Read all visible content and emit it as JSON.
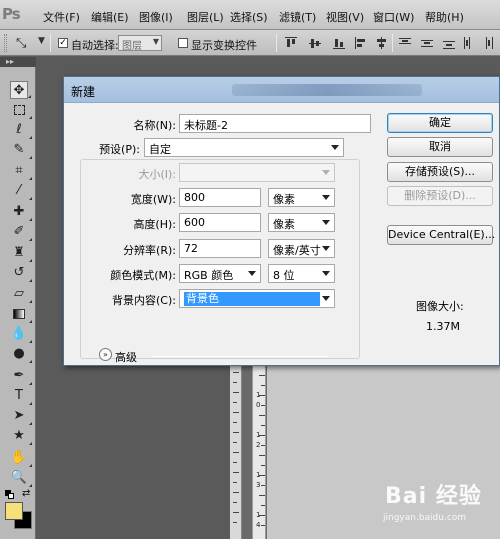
{
  "app": {
    "logo": "Ps"
  },
  "menu": [
    "文件(F)",
    "编辑(E)",
    "图像(I)",
    "图层(L)",
    "选择(S)",
    "滤镜(T)",
    "视图(V)",
    "窗口(W)",
    "帮助(H)"
  ],
  "options_bar": {
    "auto_select_label": "自动选择:",
    "auto_select_checked": true,
    "auto_select_target": "图层",
    "show_transform_label": "显示变换控件",
    "show_transform_checked": false
  },
  "toolbar": {
    "tools": [
      "move",
      "marquee",
      "lasso",
      "quick-select",
      "crop",
      "eyedropper",
      "healing-brush",
      "brush",
      "clone-stamp",
      "history-brush",
      "eraser",
      "gradient",
      "blur",
      "dodge",
      "pen",
      "type",
      "path-select",
      "shape",
      "hand",
      "zoom"
    ],
    "foreground_color": "#f5e07a",
    "background_color": "#000000"
  },
  "dialog": {
    "title": "新建",
    "name_label": "名称(N):",
    "name_value": "未标题-2",
    "preset_label": "预设(P):",
    "preset_value": "自定",
    "size_label": "大小(I):",
    "width_label": "宽度(W):",
    "width_value": "800",
    "width_unit": "像素",
    "height_label": "高度(H):",
    "height_value": "600",
    "height_unit": "像素",
    "resolution_label": "分辨率(R):",
    "resolution_value": "72",
    "resolution_unit": "像素/英寸",
    "color_mode_label": "颜色模式(M):",
    "color_mode_value": "RGB 颜色",
    "bit_depth_value": "8 位",
    "bg_contents_label": "背景内容(C):",
    "bg_contents_value": "背景色",
    "advanced_label": "高级",
    "buttons": {
      "ok": "确定",
      "cancel": "取消",
      "save_preset": "存储预设(S)...",
      "delete_preset": "删除预设(D)...",
      "device_central": "Device Central(E)..."
    },
    "image_size_label": "图像大小:",
    "image_size_value": "1.37M"
  },
  "ruler_numbers": [
    "1",
    "0",
    "1",
    "2",
    "1",
    "3",
    "1",
    "4"
  ],
  "watermark": {
    "brand": "Bai 经验",
    "url": "jingyan.baidu.com"
  }
}
